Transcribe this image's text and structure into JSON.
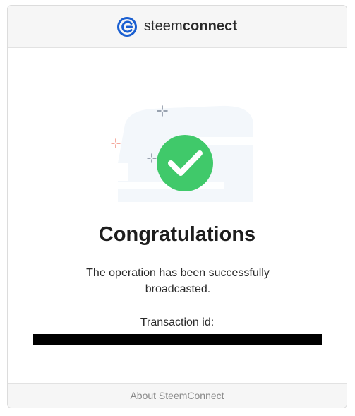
{
  "header": {
    "brand_light": "steem",
    "brand_bold": "connect",
    "logo_icon": "steemconnect-logo-icon",
    "accent_color": "#1a5fd1"
  },
  "main": {
    "status_icon": "check-circle-icon",
    "success_color": "#40c96a",
    "title": "Congratulations",
    "message": "The operation has been successfully broadcasted.",
    "transaction_label": "Transaction id:",
    "transaction_value": "redacted"
  },
  "footer": {
    "link_label": "About SteemConnect"
  }
}
